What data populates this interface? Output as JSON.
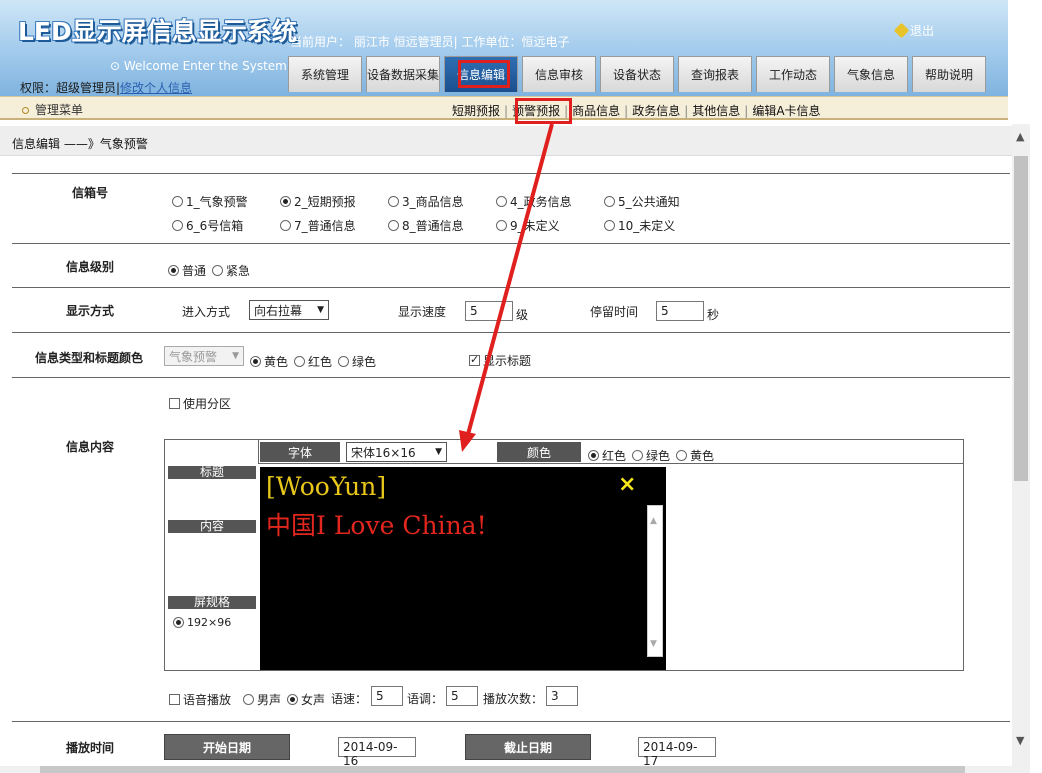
{
  "header": {
    "title": "LED显示屏信息显示系统",
    "current_user": "当前用户： 丽江市 恒远管理员| 工作单位：恒远电子",
    "logout": "退出",
    "welcome": "⊙ Welcome Enter the System",
    "role_prefix": "权限：超级管理员|",
    "change_info": "修改个人信息"
  },
  "tabs": [
    "系统管理",
    "设备数据采集",
    "信息编辑",
    "信息审核",
    "设备状态",
    "查询报表",
    "工作动态",
    "气象信息",
    "帮助说明"
  ],
  "subnav": {
    "menu_label": "管理菜单",
    "links": [
      "短期预报",
      "预警预报",
      "商品信息",
      "政务信息",
      "其他信息",
      "编辑A卡信息"
    ]
  },
  "breadcrumb": "信息编辑 ——》气象预警",
  "form": {
    "mailbox": {
      "label": "信箱号",
      "options": [
        "1_气象预警",
        "2_短期预报",
        "3_商品信息",
        "4_政务信息",
        "5_公共通知",
        "6_6号信箱",
        "7_普通信息",
        "8_普通信息",
        "9_未定义",
        "10_未定义"
      ],
      "selected": "2_短期预报"
    },
    "level": {
      "label": "信息级别",
      "options": [
        "普通",
        "紧急"
      ],
      "selected": "普通"
    },
    "display": {
      "label": "显示方式",
      "enter_label": "进入方式",
      "enter_value": "向右拉幕",
      "speed_label": "显示速度",
      "speed_value": "5",
      "speed_unit": "级",
      "stay_label": "停留时间",
      "stay_value": "5",
      "stay_unit": "秒"
    },
    "type_color": {
      "label": "信息类型和标题颜色",
      "type_value": "气象预警",
      "colors": [
        "黄色",
        "红色",
        "绿色"
      ],
      "selected": "黄色",
      "show_title": "显示标题"
    },
    "use_partition": "使用分区",
    "content": {
      "label": "信息内容",
      "font_label": "字体",
      "font_value": "宋体16×16",
      "color_label": "颜色",
      "colors": [
        "红色",
        "绿色",
        "黄色"
      ],
      "selected": "红色",
      "title_label": "标题",
      "body_label": "内容",
      "screen_spec_label": "屏规格",
      "screen_spec": "192×96",
      "screen_title": "[WooYun]",
      "screen_body": "中国I Love China!",
      "close": "×"
    },
    "voice": {
      "play_label": "语音播放",
      "voices": [
        "男声",
        "女声"
      ],
      "selected": "女声",
      "speed_label": "语速：",
      "speed": "5",
      "tone_label": "语调：",
      "tone": "5",
      "count_label": "播放次数：",
      "count": "3"
    },
    "schedule": {
      "label": "播放时间",
      "start_label": "开始日期",
      "start": "2014-09-16",
      "end_label": "截止日期",
      "end": "2014-09-17"
    }
  },
  "colors": {
    "highlight": "#e0201e",
    "header_blue": "#7fb3df",
    "led_yellow": "#e8c71a",
    "led_red": "#e3261e"
  }
}
